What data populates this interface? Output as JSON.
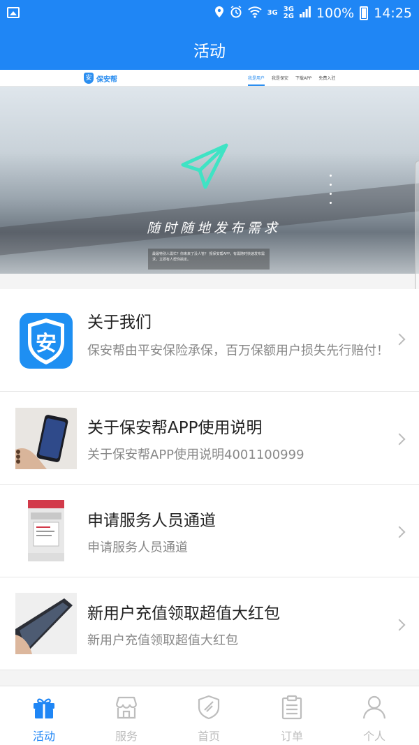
{
  "status_bar": {
    "battery": "100%",
    "time": "14:25",
    "net_top": "3G",
    "net_bottom": "2G",
    "net_left": "3G",
    "icons": [
      "image-icon",
      "location-icon",
      "alarm-icon",
      "wifi-icon",
      "signal-icon",
      "battery-icon"
    ]
  },
  "app_bar": {
    "title": "活动"
  },
  "banner": {
    "logo_mark": "安",
    "logo_text": "保安帮",
    "nav_links": [
      "我是用户",
      "我是保安",
      "下载APP",
      "免费入驻"
    ],
    "slogan": "随时随地发布需求",
    "note": "最最特别人需忙？你来来了没人管？ 报保安帮APP，有需随时快速发布需求，立即有人帮你搞定。",
    "carousel_count": 4,
    "carousel_active": 1
  },
  "accent_color": "#1f86f5",
  "items": [
    {
      "title": "关于我们",
      "desc": "保安帮由平安保险承保，百万保额用户损失先行赔付！",
      "thumb_icon": "shield-logo-icon"
    },
    {
      "title": "关于保安帮APP使用说明",
      "desc": "关于保安帮APP使用说明4001100999",
      "thumb_icon": "phone-photo"
    },
    {
      "title": "申请服务人员通道",
      "desc": "申请服务人员通道",
      "thumb_icon": "app-screenshot"
    },
    {
      "title": "新用户充值领取超值大红包",
      "desc": "新用户充值领取超值大红包",
      "thumb_icon": "phone-photo"
    }
  ],
  "tabs": [
    {
      "label": "活动",
      "icon": "gift-icon",
      "active": true
    },
    {
      "label": "服务",
      "icon": "shop-icon",
      "active": false
    },
    {
      "label": "首页",
      "icon": "shield-icon",
      "active": false
    },
    {
      "label": "订单",
      "icon": "clipboard-icon",
      "active": false
    },
    {
      "label": "个人",
      "icon": "person-icon",
      "active": false
    }
  ]
}
